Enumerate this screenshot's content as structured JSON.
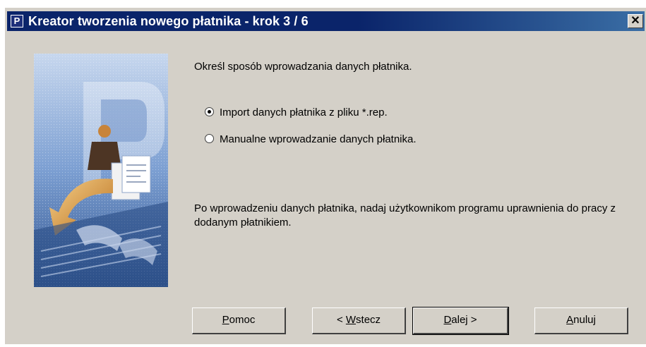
{
  "window": {
    "title": "Kreator tworzenia nowego płatnika - krok 3 / 6",
    "app_icon_letter": "P",
    "close_glyph": "✕"
  },
  "content": {
    "prompt": "Określ sposób wprowadzania danych płatnika.",
    "options": [
      {
        "label": "Import danych płatnika z pliku *.rep.",
        "selected": true
      },
      {
        "label": "Manualne wprowadzanie danych płatnika.",
        "selected": false
      }
    ],
    "info": "Po wprowadzeniu danych płatnika, nadaj użytkownikom programu uprawnienia do pracy z dodanym płatnikiem."
  },
  "buttons": {
    "help": {
      "mnemonic": "P",
      "rest": "omoc"
    },
    "back": {
      "prefix": "< ",
      "mnemonic": "W",
      "rest": "stecz"
    },
    "next": {
      "mnemonic": "D",
      "rest": "alej >"
    },
    "cancel": {
      "mnemonic": "A",
      "rest": "nuluj"
    }
  },
  "colors": {
    "titlebar": "#0a246a",
    "dialog_face": "#d4d0c8"
  }
}
